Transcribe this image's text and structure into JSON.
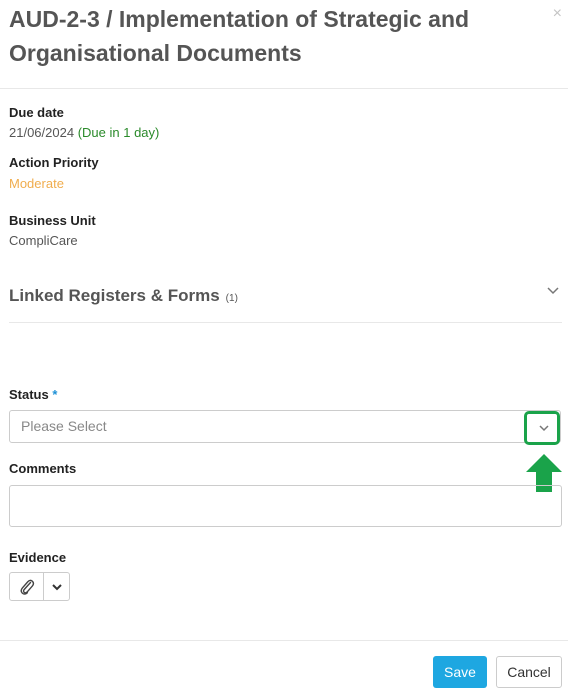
{
  "header": {
    "title": "AUD-2-3 / Implementation of Strategic and Organisational Documents",
    "close_label": "×"
  },
  "details": {
    "due_date_label": "Due date",
    "due_date_value": "21/06/2024",
    "due_status": "(Due in 1 day)",
    "priority_label": "Action Priority",
    "priority_value": "Moderate",
    "business_unit_label": "Business Unit",
    "business_unit_value": "CompliCare"
  },
  "linked_section": {
    "title": "Linked Registers & Forms",
    "count": "(1)",
    "icon": "chevron-down-icon"
  },
  "form": {
    "status_label": "Status",
    "required_marker": "*",
    "status_placeholder": "Please Select",
    "comments_label": "Comments",
    "evidence_label": "Evidence",
    "evidence_icons": [
      "paperclip-icon",
      "chevron-down-icon"
    ]
  },
  "footer": {
    "save_label": "Save",
    "cancel_label": "Cancel"
  },
  "annotation": {
    "highlight_color": "#1aa34a",
    "arrow_color": "#1aa34a"
  },
  "colors": {
    "due_status": "#2a8a2a",
    "priority": "#f0ad4e",
    "required_marker": "#1e90d6",
    "save_button": "#1ea7e1"
  }
}
